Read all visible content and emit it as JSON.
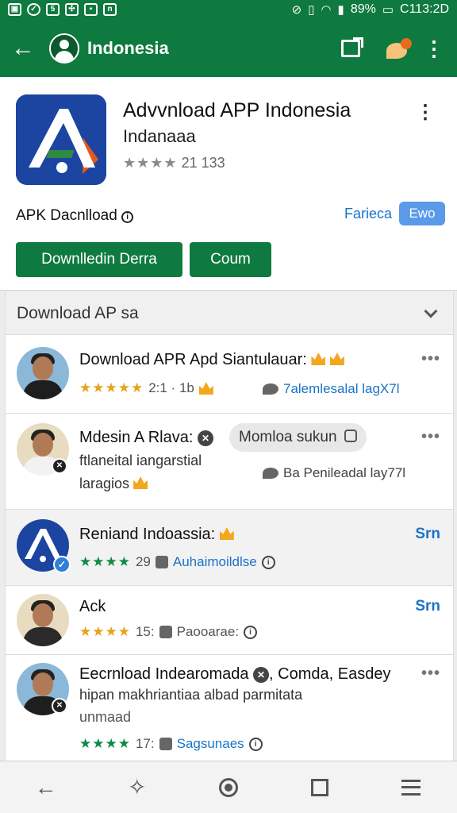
{
  "status_bar": {
    "battery": "89%",
    "time_text": "C113:2D"
  },
  "toolbar": {
    "title": "Indonesia"
  },
  "app": {
    "title": "Advvnload APP Indonesia",
    "subtitle": "Indanaaa",
    "stars": "★★★★",
    "rating_text": "21  133",
    "apk_label": "APK Dacnlload",
    "fav_link": "Farieca",
    "fav_badge": "Ewo",
    "primary_button": "Downlledin Derra",
    "secondary_button": "Coum"
  },
  "section": {
    "header": "Download AP sa"
  },
  "items": [
    {
      "title": "Download APR Apd Siantulauar:",
      "stars": "★★★★★",
      "meta": "2:1 · 1b",
      "right_text": "7alemlesalal lagX7l"
    },
    {
      "title": "Mdesin A Rlava:",
      "chip": "Momloa sukun",
      "line2": "ftlaneital iangarstial",
      "line3": "laragios",
      "right_text": "Ba Penileadal lay77l"
    },
    {
      "title": "Reniand Indoassia:",
      "stars": "★★★★",
      "meta": "29",
      "link": "Auhaimoildlse",
      "action": "Srn"
    },
    {
      "title": "Ack",
      "stars": "★★★★",
      "meta": "15:",
      "meta2": "Paooarae:",
      "action": "Srn"
    },
    {
      "title": "Eecrnload Indearomada",
      "title_rest": ", Comda, Easdey",
      "line2": "hipan makhriantiaa albad parmitata",
      "line3": "unmaad",
      "stars": "★★★★",
      "meta": "17:",
      "link": "Sagsunaes"
    }
  ],
  "colors": {
    "brand_green": "#0f7a3f",
    "link_blue": "#1a73c8",
    "star_gold": "#e8a21c",
    "star_green": "#0f8a45"
  },
  "icons": [
    "back-arrow-icon",
    "user-icon",
    "screen-cast-icon",
    "notification-icon",
    "more-vert-icon",
    "info-icon",
    "chevron-down-icon",
    "crown-icon",
    "share-icon",
    "close-circle-icon",
    "lock-icon",
    "check-icon",
    "puzzle-icon",
    "nav-back-icon",
    "nav-assist-icon",
    "nav-home-icon",
    "nav-recents-icon",
    "nav-menu-icon"
  ]
}
